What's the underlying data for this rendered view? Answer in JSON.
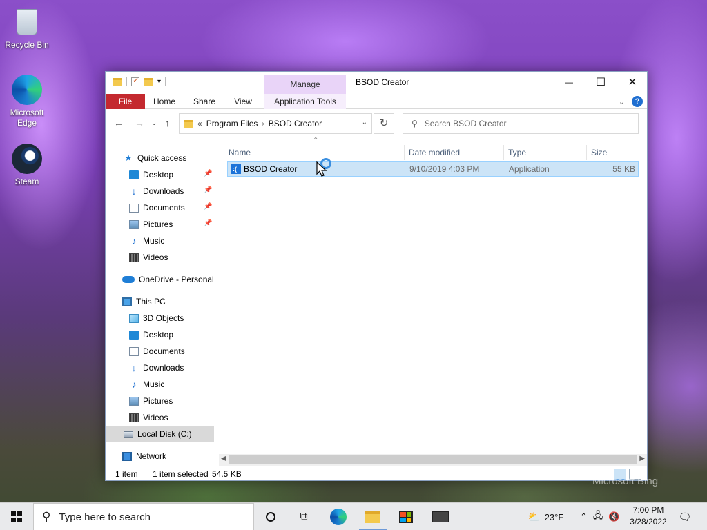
{
  "desktop": {
    "icons": [
      {
        "label": "Recycle Bin",
        "icon": "recycle-bin-icon"
      },
      {
        "label": "Microsoft Edge",
        "icon": "edge-icon"
      },
      {
        "label": "Steam",
        "icon": "steam-icon"
      }
    ],
    "watermark": "Microsoft Bing"
  },
  "window": {
    "title": "BSOD Creator",
    "manage_tab": "Manage",
    "controls": {
      "minimize": "—",
      "maximize": "☐",
      "close": "✕"
    },
    "ribbon_tabs": [
      "File",
      "Home",
      "Share",
      "View",
      "Application Tools"
    ],
    "help": "?"
  },
  "nav": {
    "address": {
      "prefix": "«",
      "crumbs": [
        "Program Files",
        "BSOD Creator"
      ]
    },
    "search_placeholder": "Search BSOD Creator"
  },
  "sidebar": {
    "quick_access": {
      "label": "Quick access",
      "items": [
        {
          "label": "Desktop",
          "icon": "desktop-folder-icon",
          "pinned": true
        },
        {
          "label": "Downloads",
          "icon": "downloads-icon",
          "pinned": true
        },
        {
          "label": "Documents",
          "icon": "documents-icon",
          "pinned": true
        },
        {
          "label": "Pictures",
          "icon": "pictures-icon",
          "pinned": true
        },
        {
          "label": "Music",
          "icon": "music-icon",
          "pinned": false
        },
        {
          "label": "Videos",
          "icon": "videos-icon",
          "pinned": false
        }
      ]
    },
    "onedrive": "OneDrive - Personal",
    "this_pc": {
      "label": "This PC",
      "items": [
        {
          "label": "3D Objects",
          "icon": "3d-objects-icon"
        },
        {
          "label": "Desktop",
          "icon": "desktop-folder-icon"
        },
        {
          "label": "Documents",
          "icon": "documents-icon"
        },
        {
          "label": "Downloads",
          "icon": "downloads-icon"
        },
        {
          "label": "Music",
          "icon": "music-icon"
        },
        {
          "label": "Pictures",
          "icon": "pictures-icon"
        },
        {
          "label": "Videos",
          "icon": "videos-icon"
        },
        {
          "label": "Local Disk (C:)",
          "icon": "local-disk-icon",
          "selected": true
        }
      ]
    },
    "network": "Network"
  },
  "filelist": {
    "columns": [
      "Name",
      "Date modified",
      "Type",
      "Size"
    ],
    "rows": [
      {
        "name": "BSOD Creator",
        "date": "9/10/2019 4:03 PM",
        "type": "Application",
        "size": "55 KB",
        "selected": true
      }
    ]
  },
  "status": {
    "count": "1 item",
    "selection": "1 item selected",
    "selection_size": "54.5 KB"
  },
  "taskbar": {
    "search_placeholder": "Type here to search",
    "weather": "23°F",
    "time": "7:00 PM",
    "date": "3/28/2022"
  },
  "colors": {
    "file_tab": "#c4292f",
    "manage_tab": "#e9d4f8",
    "selection": "#cce4f7",
    "accent": "#1f6fd1"
  }
}
